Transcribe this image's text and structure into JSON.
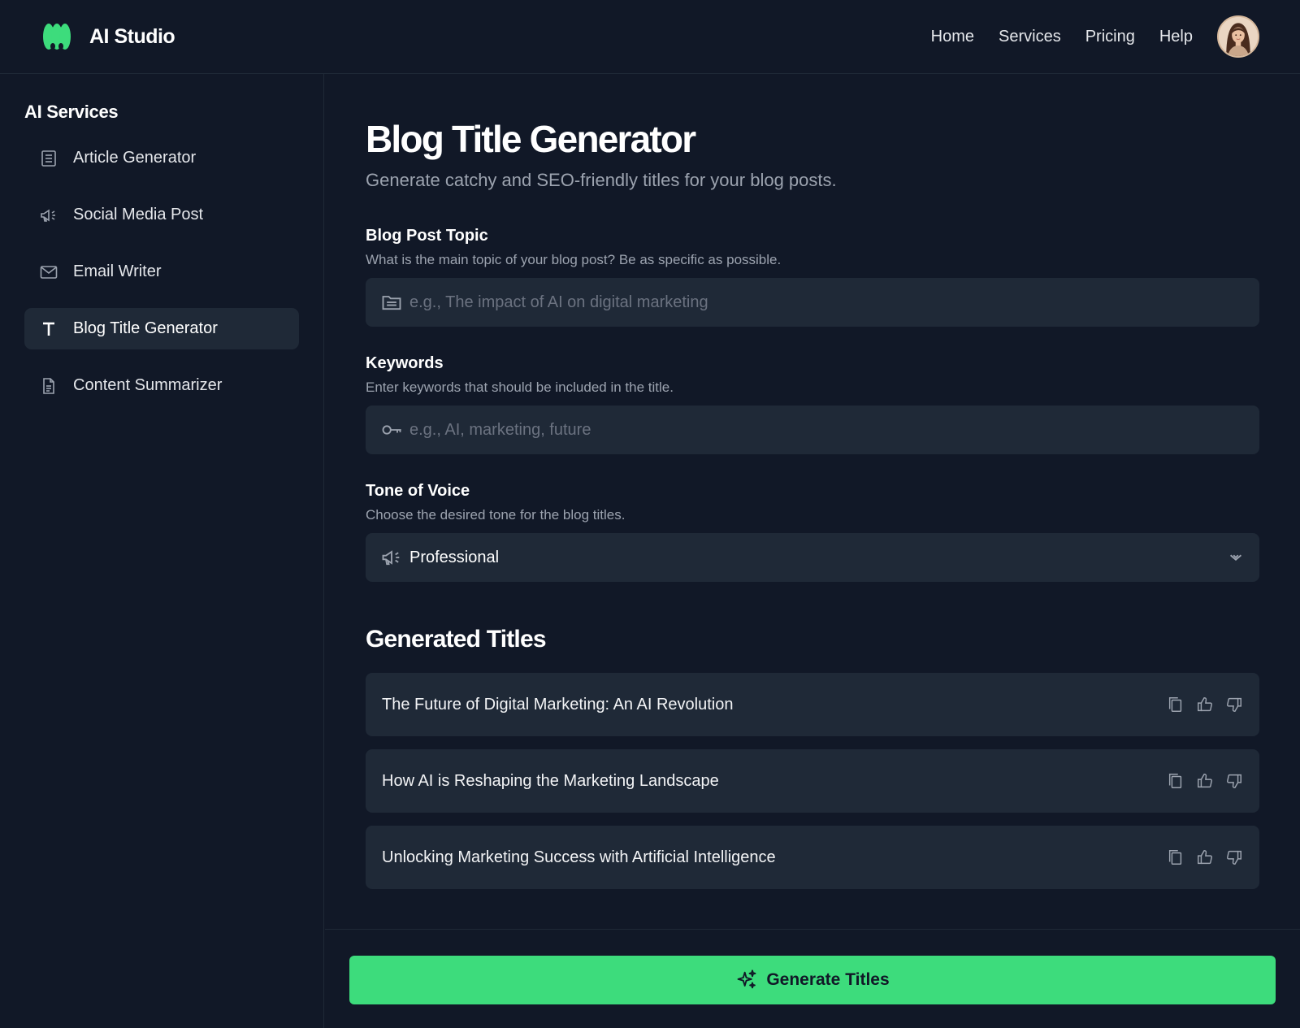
{
  "app": {
    "name": "AI Studio",
    "accent_color": "#3ddc7c",
    "logo_icon": "green-wave-logo"
  },
  "topnav": {
    "items": [
      {
        "label": "Home"
      },
      {
        "label": "Services"
      },
      {
        "label": "Pricing"
      },
      {
        "label": "Help"
      }
    ],
    "avatar_icon": "user-avatar"
  },
  "sidebar": {
    "title": "AI Services",
    "items": [
      {
        "label": "Article Generator",
        "icon": "article-icon",
        "active": false
      },
      {
        "label": "Social Media Post",
        "icon": "megaphone-icon",
        "active": false
      },
      {
        "label": "Email Writer",
        "icon": "envelope-icon",
        "active": false
      },
      {
        "label": "Blog Title Generator",
        "icon": "text-t-icon",
        "active": true
      },
      {
        "label": "Content Summarizer",
        "icon": "document-icon",
        "active": false
      }
    ]
  },
  "main": {
    "title": "Blog Title Generator",
    "subtitle": "Generate catchy and SEO-friendly titles for your blog posts.",
    "fields": {
      "topic": {
        "label": "Blog Post Topic",
        "help": "What is the main topic of your blog post? Be as specific as possible.",
        "placeholder": "e.g., The impact of AI on digital marketing",
        "value": "",
        "icon": "folder-icon"
      },
      "keywords": {
        "label": "Keywords",
        "help": "Enter keywords that should be included in the title.",
        "placeholder": "e.g., AI, marketing, future",
        "value": "",
        "icon": "key-icon"
      },
      "tone": {
        "label": "Tone of Voice",
        "help": "Choose the desired tone for the blog titles.",
        "selected": "Professional",
        "icon": "megaphone-icon"
      }
    },
    "results_title": "Generated Titles",
    "results": [
      {
        "text": "The Future of Digital Marketing: An AI Revolution"
      },
      {
        "text": "How AI is Reshaping the Marketing Landscape"
      },
      {
        "text": "Unlocking Marketing Success with Artificial Intelligence"
      }
    ]
  },
  "footer": {
    "generate_label": "Generate Titles",
    "generate_icon": "sparkles-icon"
  }
}
